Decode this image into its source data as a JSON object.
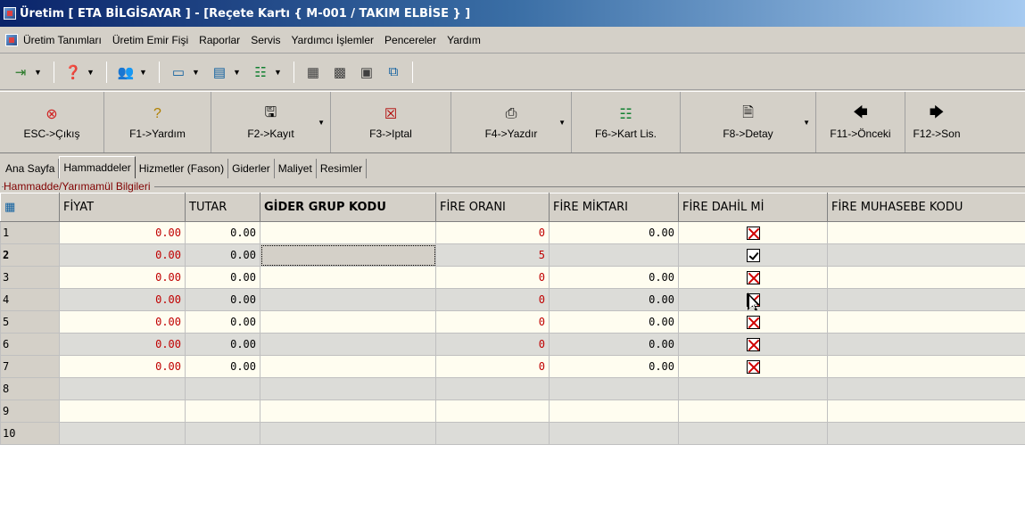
{
  "window": {
    "title": "Üretim [ ETA BİLGİSAYAR ] - [Reçete Kartı { M-001 / TAKIM ELBİSE } ]"
  },
  "menu": [
    "Üretim Tanımları",
    "Üretim Emir Fişi",
    "Raporlar",
    "Servis",
    "Yardımcı İşlemler",
    "Pencereler",
    "Yardım"
  ],
  "commands": [
    {
      "label": "ESC->Çıkış",
      "icon": "cancel-icon"
    },
    {
      "label": "F1->Yardım",
      "icon": "help-icon"
    },
    {
      "label": "F2->Kayıt",
      "icon": "save-icon"
    },
    {
      "label": "F3->Iptal",
      "icon": "delete-icon"
    },
    {
      "label": "F4->Yazdır",
      "icon": "print-icon"
    },
    {
      "label": "F6->Kart Lis.",
      "icon": "list-icon"
    },
    {
      "label": "F8->Detay",
      "icon": "detail-icon"
    },
    {
      "label": "F11->Önceki",
      "icon": "arrow-left-icon"
    },
    {
      "label": "F12->Son",
      "icon": "arrow-right-icon"
    }
  ],
  "tabs": [
    "Ana Sayfa",
    "Hammaddeler",
    "Hizmetler (Fason)",
    "Giderler",
    "Maliyet",
    "Resimler"
  ],
  "active_tab": "Hammaddeler",
  "group_label": "Hammadde/Yarımamül Bilgileri",
  "grid": {
    "columns": [
      "FİYAT",
      "TUTAR",
      "GİDER GRUP KODU",
      "FİRE ORANI",
      "FİRE MİKTARI",
      "FİRE DAHİL Mİ",
      "FİRE MUHASEBE KODU"
    ],
    "rows": [
      {
        "n": "1",
        "fiyat": "0.00",
        "tutar": "0.00",
        "gider": "",
        "oran": "0",
        "miktar": "0.00",
        "dahil": "x"
      },
      {
        "n": "2",
        "fiyat": "0.00",
        "tutar": "0.00",
        "gider": "",
        "oran": "5",
        "miktar": "",
        "dahil": "check"
      },
      {
        "n": "3",
        "fiyat": "0.00",
        "tutar": "0.00",
        "gider": "",
        "oran": "0",
        "miktar": "0.00",
        "dahil": "x"
      },
      {
        "n": "4",
        "fiyat": "0.00",
        "tutar": "0.00",
        "gider": "",
        "oran": "0",
        "miktar": "0.00",
        "dahil": "x"
      },
      {
        "n": "5",
        "fiyat": "0.00",
        "tutar": "0.00",
        "gider": "",
        "oran": "0",
        "miktar": "0.00",
        "dahil": "x"
      },
      {
        "n": "6",
        "fiyat": "0.00",
        "tutar": "0.00",
        "gider": "",
        "oran": "0",
        "miktar": "0.00",
        "dahil": "x"
      },
      {
        "n": "7",
        "fiyat": "0.00",
        "tutar": "0.00",
        "gider": "",
        "oran": "0",
        "miktar": "0.00",
        "dahil": "x"
      },
      {
        "n": "8",
        "fiyat": "",
        "tutar": "",
        "gider": "",
        "oran": "",
        "miktar": "",
        "dahil": ""
      },
      {
        "n": "9",
        "fiyat": "",
        "tutar": "",
        "gider": "",
        "oran": "",
        "miktar": "",
        "dahil": ""
      },
      {
        "n": "10",
        "fiyat": "",
        "tutar": "",
        "gider": "",
        "oran": "",
        "miktar": "",
        "dahil": ""
      }
    ]
  },
  "colors": {
    "accent": "#0a246a",
    "group_label": "#800000",
    "checkbox_x": "#d00000"
  }
}
